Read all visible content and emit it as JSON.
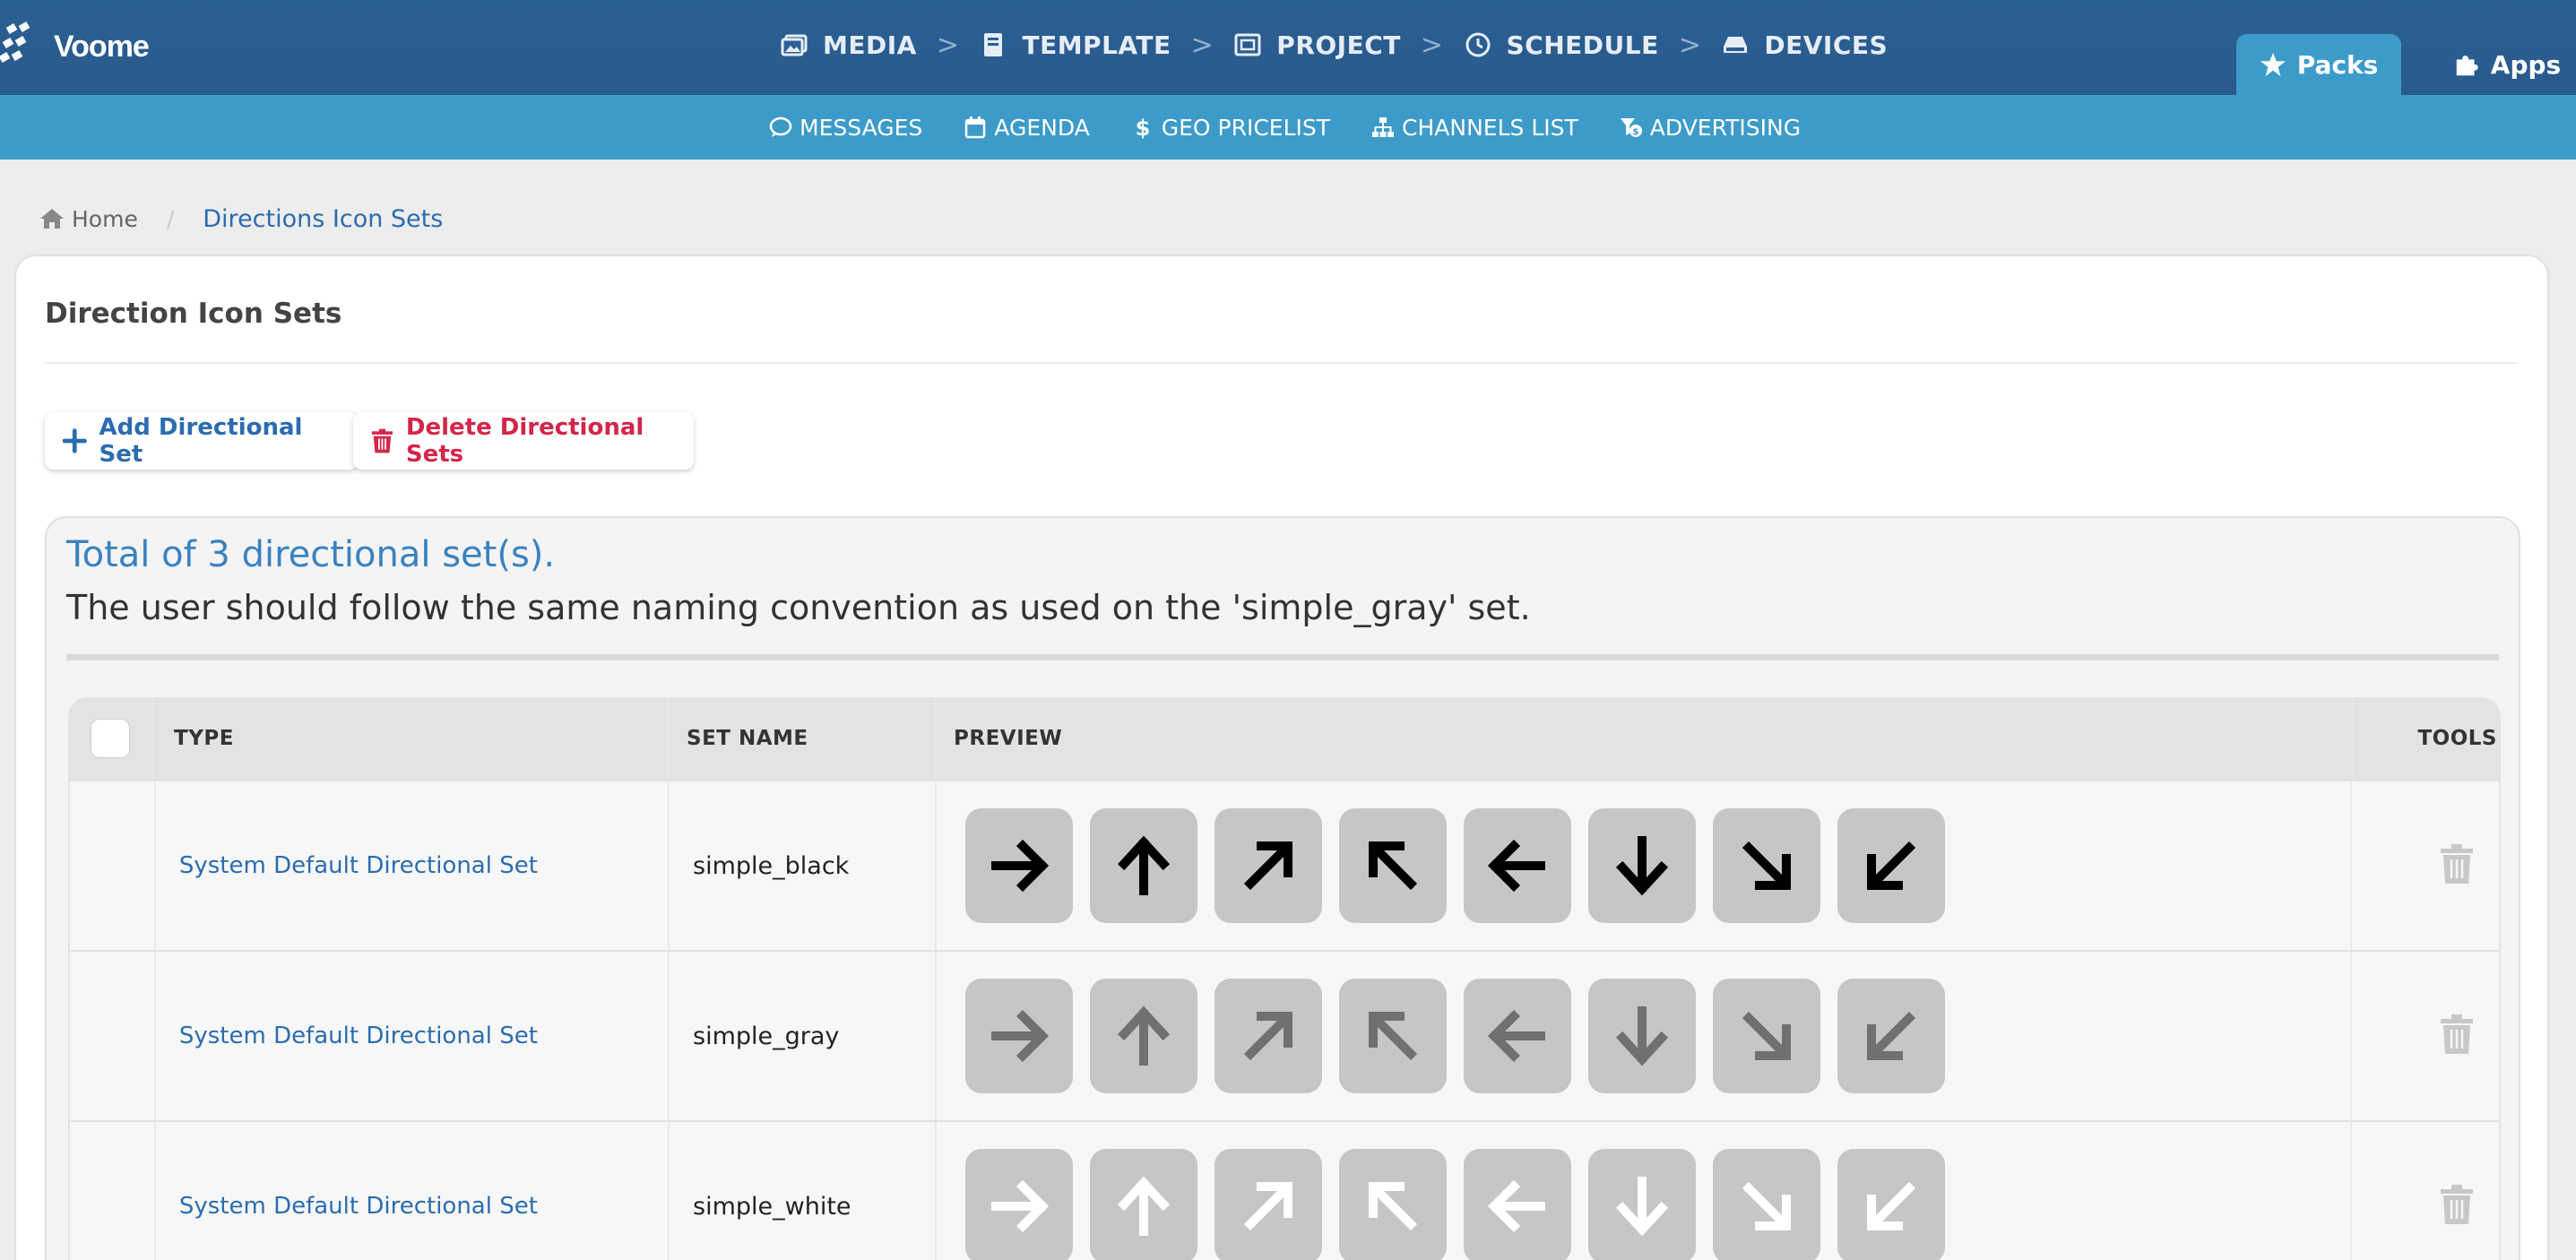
{
  "brand": {
    "name": "Voome"
  },
  "main_nav": [
    {
      "label": "MEDIA",
      "icon": "images-icon"
    },
    {
      "label": "TEMPLATE",
      "icon": "book-icon"
    },
    {
      "label": "PROJECT",
      "icon": "picture-frame-icon"
    },
    {
      "label": "SCHEDULE",
      "icon": "clock-icon"
    },
    {
      "label": "DEVICES",
      "icon": "hard-drive-icon"
    }
  ],
  "nav_separator": ">",
  "right_tabs": {
    "packs": "Packs",
    "apps": "Apps"
  },
  "sub_nav": [
    {
      "label": "MESSAGES",
      "icon": "comment-icon"
    },
    {
      "label": "AGENDA",
      "icon": "calendar-icon"
    },
    {
      "label": "GEO PRICELIST",
      "icon": "dollar-icon"
    },
    {
      "label": "CHANNELS LIST",
      "icon": "sitemap-icon"
    },
    {
      "label": "ADVERTISING",
      "icon": "funnel-dollar-icon"
    }
  ],
  "breadcrumb": {
    "home": "Home",
    "separator": "/",
    "current": "Directions Icon Sets"
  },
  "card": {
    "title": "Direction Icon Sets"
  },
  "buttons": {
    "add": "Add Directional Set",
    "delete": "Delete Directional Sets"
  },
  "summary": {
    "total": "Total of 3 directional set(s).",
    "note": "The user should follow the same naming convention as used on the 'simple_gray' set."
  },
  "table": {
    "headers": {
      "type": "TYPE",
      "set_name": "SET NAME",
      "preview": "PREVIEW",
      "tools": "TOOLS"
    },
    "rows": [
      {
        "type": "System Default Directional Set",
        "set_name": "simple_black",
        "arrow_color": "#000000"
      },
      {
        "type": "System Default Directional Set",
        "set_name": "simple_gray",
        "arrow_color": "#707070"
      },
      {
        "type": "System Default Directional Set",
        "set_name": "simple_white",
        "arrow_color": "#ffffff"
      }
    ],
    "preview_arrows": [
      "arrow-right-icon",
      "arrow-up-icon",
      "arrow-up-right-icon",
      "arrow-up-left-icon",
      "arrow-left-icon",
      "arrow-down-icon",
      "arrow-down-right-icon",
      "arrow-down-left-icon"
    ]
  },
  "colors": {
    "topbar": "#2a5f93",
    "subbar": "#3c9bc9",
    "link": "#2b6cb0",
    "danger": "#d3264a",
    "tile_bg": "#c6c6c6",
    "trash": "#c8c8c8"
  }
}
